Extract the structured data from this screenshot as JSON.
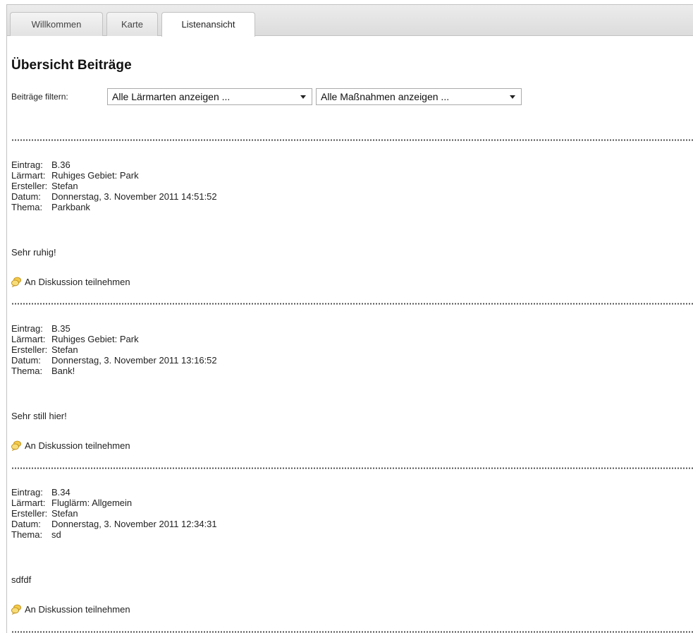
{
  "tabs": [
    {
      "label": "Willkommen",
      "active": false
    },
    {
      "label": "Karte",
      "active": false
    },
    {
      "label": "Listenansicht",
      "active": true
    }
  ],
  "page_title": "Übersicht Beiträge",
  "filter": {
    "label": "Beiträge filtern:",
    "noise_select": "Alle Lärmarten anzeigen ...",
    "measures_select": "Alle Maßnahmen anzeigen ..."
  },
  "labels": {
    "entry": "Eintrag:",
    "noise": "Lärmart:",
    "author": "Ersteller:",
    "date": "Datum:",
    "topic": "Thema:",
    "discuss_link": "An Diskussion teilnehmen"
  },
  "entries": [
    {
      "id": "B.36",
      "noise": "Ruhiges Gebiet: Park",
      "author": "Stefan",
      "date": "Donnerstag, 3. November 2011 14:51:52",
      "topic": "Parkbank",
      "text": "Sehr ruhig!"
    },
    {
      "id": "B.35",
      "noise": "Ruhiges Gebiet: Park",
      "author": "Stefan",
      "date": "Donnerstag, 3. November 2011 13:16:52",
      "topic": "Bank!",
      "text": "Sehr still hier!"
    },
    {
      "id": "B.34",
      "noise": "Fluglärm: Allgemein",
      "author": "Stefan",
      "date": "Donnerstag, 3. November 2011 12:34:31",
      "topic": "sd",
      "text": "sdfdf"
    }
  ],
  "colors": {
    "separator": "#444444",
    "icon_bubble": "#f2c94c"
  }
}
